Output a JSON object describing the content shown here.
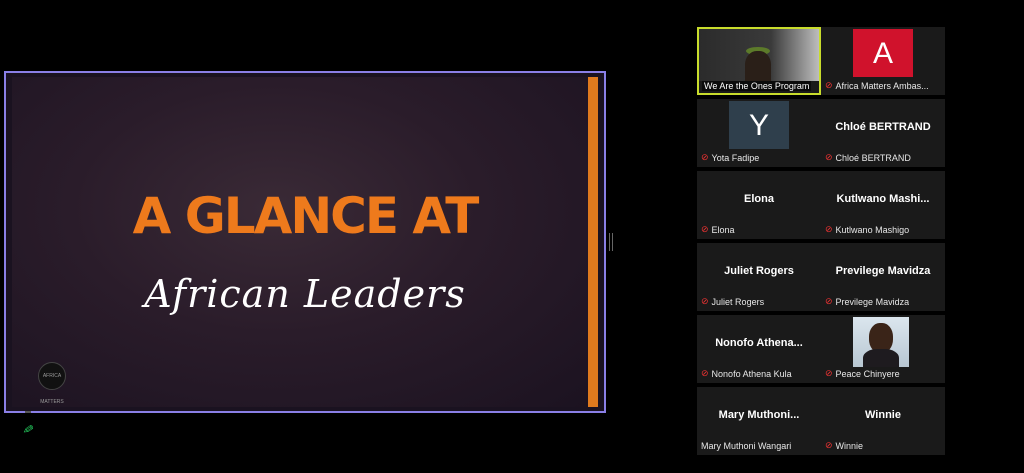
{
  "slide": {
    "title": "A GLANCE AT",
    "subtitle": "African Leaders",
    "accent_color": "#ee7a1c",
    "logo_text": "AFRICA MATTERS"
  },
  "participants": [
    {
      "name": "We Are the Ones Program",
      "label": "We Are the Ones Program",
      "type": "video",
      "active": true,
      "muted": false
    },
    {
      "name": "Africa Matters Ambas...",
      "label": "Africa Matters Ambas...",
      "type": "letter",
      "letter": "A",
      "color": "#d0122c",
      "muted": true
    },
    {
      "name": "Yota Fadipe",
      "label": "Yota Fadipe",
      "type": "letter",
      "letter": "Y",
      "color": "#2f3f4c",
      "muted": true
    },
    {
      "name": "Chloé BERTRAND",
      "label": "Chloé BERTRAND",
      "type": "name",
      "muted": true
    },
    {
      "name": "Elona",
      "label": "Elona",
      "type": "name",
      "muted": true
    },
    {
      "name": "Kutlwano  Mashi...",
      "label": "Kutlwano Mashigo",
      "type": "name",
      "muted": true
    },
    {
      "name": "Juliet Rogers",
      "label": "Juliet Rogers",
      "type": "name",
      "muted": true
    },
    {
      "name": "Previlege Mavidza",
      "label": "Previlege Mavidza",
      "type": "name",
      "muted": true
    },
    {
      "name": "Nonofo  Athena...",
      "label": "Nonofo Athena Kula",
      "type": "name",
      "muted": true
    },
    {
      "name": "Peace Chinyere",
      "label": "Peace Chinyere",
      "type": "photo",
      "muted": true
    },
    {
      "name": "Mary  Muthoni...",
      "label": "Mary Muthoni Wangari",
      "type": "name",
      "muted": false
    },
    {
      "name": "Winnie",
      "label": "Winnie",
      "type": "name",
      "muted": true
    }
  ]
}
